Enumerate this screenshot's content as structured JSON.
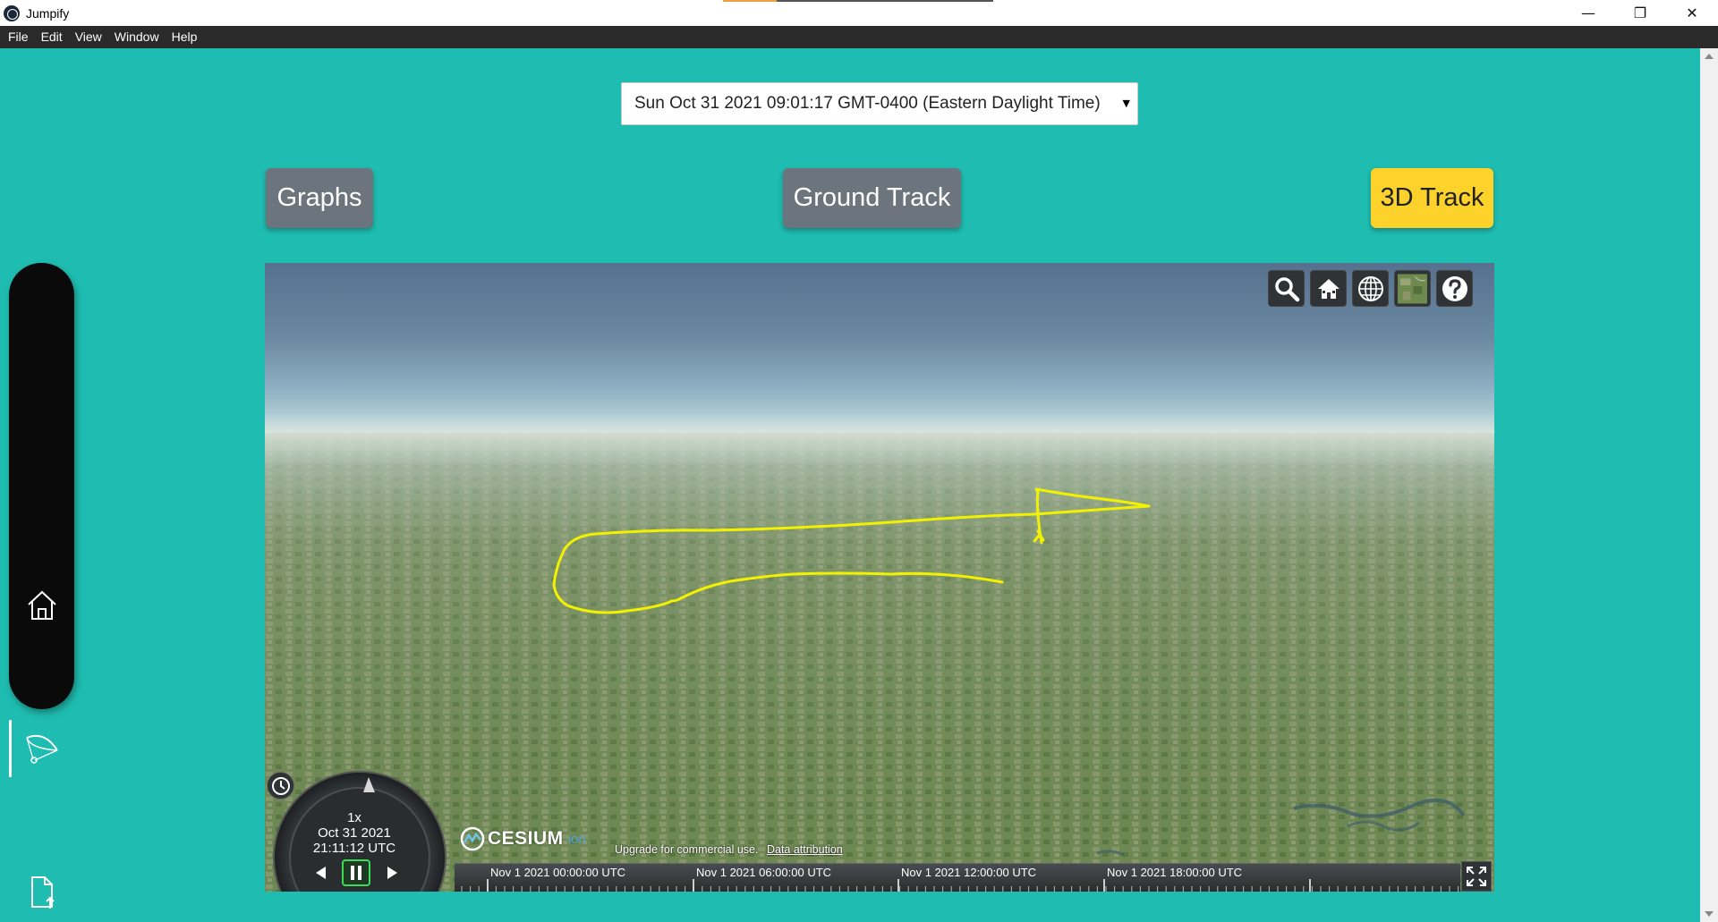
{
  "window": {
    "title": "Jumpify",
    "minimize_glyph": "—",
    "restore_glyph": "❐",
    "close_glyph": "✕"
  },
  "menu": [
    "File",
    "Edit",
    "View",
    "Window",
    "Help"
  ],
  "date_select": {
    "value": "Sun Oct 31 2021 09:01:17 GMT-0400 (Eastern Daylight Time)",
    "caret": "▼"
  },
  "views": {
    "graphs": "Graphs",
    "ground_track": "Ground Track",
    "track_3d": "3D Track",
    "active": "3D Track"
  },
  "sidebar": {
    "items": [
      {
        "name": "home",
        "icon": "home-icon"
      },
      {
        "name": "parachute",
        "icon": "parachute-icon",
        "active": true
      },
      {
        "name": "upload",
        "icon": "file-upload-icon"
      }
    ]
  },
  "viewer": {
    "toolbar": [
      "search-icon",
      "home-view-icon",
      "globe-icon",
      "base-layer-icon",
      "help-icon"
    ],
    "animation": {
      "speed": "1x",
      "date": "Oct 31 2021",
      "time": "21:11:12 UTC"
    },
    "credits": {
      "logo": "CESIUM",
      "logo_suffix": "ion",
      "upgrade": "Upgrade for commercial use.",
      "attribution": "Data attribution"
    },
    "timeline": {
      "labels": [
        "Nov 1 2021 00:00:00 UTC",
        "Nov 1 2021 06:00:00 UTC",
        "Nov 1 2021 12:00:00 UTC",
        "Nov 1 2021 18:00:00 UTC"
      ]
    },
    "track_color": "#f2f200"
  },
  "colors": {
    "background": "#1fbdb1",
    "active_button": "#fdd22a",
    "inactive_button": "#6c757d"
  }
}
